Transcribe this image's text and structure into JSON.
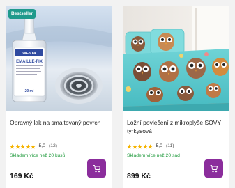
{
  "colors": {
    "badge": "#1f9a8c",
    "stock": "#1f9a3c",
    "star": "#f5b300",
    "cart_button": "#8b2d9c"
  },
  "products": [
    {
      "badge": "Bestseller",
      "image": "paint-bottle-and-sink-drain",
      "bottle_brand": "WESTA",
      "bottle_name": "EMAILLE-FIX",
      "bottle_volume": "20 ml",
      "title": "Opravný lak na smaltovaný povrch",
      "rating_value": "5,0",
      "rating_count": "(12)",
      "stars": 5,
      "stock": "Skladem více než 20 kusů",
      "price": "169 Kč",
      "cart_icon": "cart-icon"
    },
    {
      "image": "owl-print-bedding",
      "title": "Ložní povlečení z mikroplyše SOVY tyrkysová",
      "rating_value": "5,0",
      "rating_count": "(11)",
      "stars": 5,
      "stock": "Skladem více než 20 sad",
      "price": "899 Kč",
      "cart_icon": "cart-icon"
    }
  ]
}
